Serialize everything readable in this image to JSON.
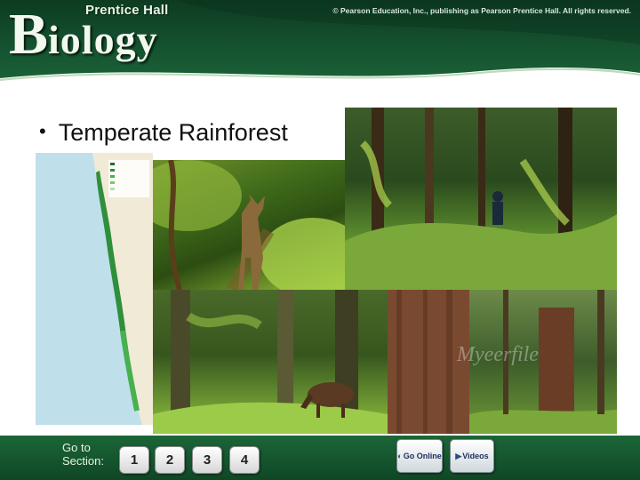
{
  "header": {
    "brand_small": "Prentice Hall",
    "brand_cap": "B",
    "brand_rest": "iology",
    "copyright": "© Pearson Education, Inc., publishing as Pearson Prentice Hall. All rights reserved."
  },
  "content": {
    "bullet": "Temperate Rainforest"
  },
  "images": {
    "map": "temperate-rainforest-range-map",
    "deer": "deer-in-rainforest",
    "hiker": "hiker-in-mossy-forest",
    "elk": "elk-grazing-in-forest",
    "trees": "giant-tree-trunks",
    "watermark": "Myeerfile"
  },
  "footer": {
    "goto_line1": "Go to",
    "goto_line2": "Section:",
    "sections": [
      "1",
      "2",
      "3",
      "4"
    ],
    "go_online": "Go Online",
    "videos": "Videos"
  },
  "colors": {
    "header_green": "#15512f",
    "footer_green": "#1c6638",
    "brand_text": "#f2f8ee"
  }
}
